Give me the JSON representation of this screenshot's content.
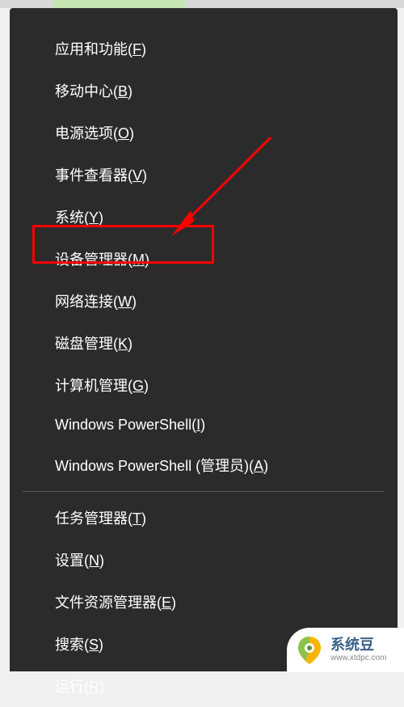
{
  "menu": {
    "groups": [
      [
        {
          "text": "应用和功能(",
          "key": "F",
          "suffix": ")",
          "name": "menu-apps-features"
        },
        {
          "text": "移动中心(",
          "key": "B",
          "suffix": ")",
          "name": "menu-mobility-center"
        },
        {
          "text": "电源选项(",
          "key": "O",
          "suffix": ")",
          "name": "menu-power-options"
        },
        {
          "text": "事件查看器(",
          "key": "V",
          "suffix": ")",
          "name": "menu-event-viewer"
        },
        {
          "text": "系统(",
          "key": "Y",
          "suffix": ")",
          "name": "menu-system"
        },
        {
          "text": "设备管理器(",
          "key": "M",
          "suffix": ")",
          "name": "menu-device-manager"
        },
        {
          "text": "网络连接(",
          "key": "W",
          "suffix": ")",
          "name": "menu-network-connections"
        },
        {
          "text": "磁盘管理(",
          "key": "K",
          "suffix": ")",
          "name": "menu-disk-management"
        },
        {
          "text": "计算机管理(",
          "key": "G",
          "suffix": ")",
          "name": "menu-computer-management"
        },
        {
          "text": "Windows PowerShell(",
          "key": "I",
          "suffix": ")",
          "name": "menu-powershell"
        },
        {
          "text": "Windows PowerShell (管理员)(",
          "key": "A",
          "suffix": ")",
          "name": "menu-powershell-admin"
        }
      ],
      [
        {
          "text": "任务管理器(",
          "key": "T",
          "suffix": ")",
          "name": "menu-task-manager"
        },
        {
          "text": "设置(",
          "key": "N",
          "suffix": ")",
          "name": "menu-settings"
        },
        {
          "text": "文件资源管理器(",
          "key": "E",
          "suffix": ")",
          "name": "menu-file-explorer"
        },
        {
          "text": "搜索(",
          "key": "S",
          "suffix": ")",
          "name": "menu-search"
        },
        {
          "text": "运行(",
          "key": "R",
          "suffix": ")",
          "name": "menu-run"
        }
      ]
    ]
  },
  "annotation": {
    "highlight_color": "#ff0000",
    "arrow_color": "#ff0000"
  },
  "watermark": {
    "cn": "系统豆",
    "en": "www.xtdpc.com"
  }
}
